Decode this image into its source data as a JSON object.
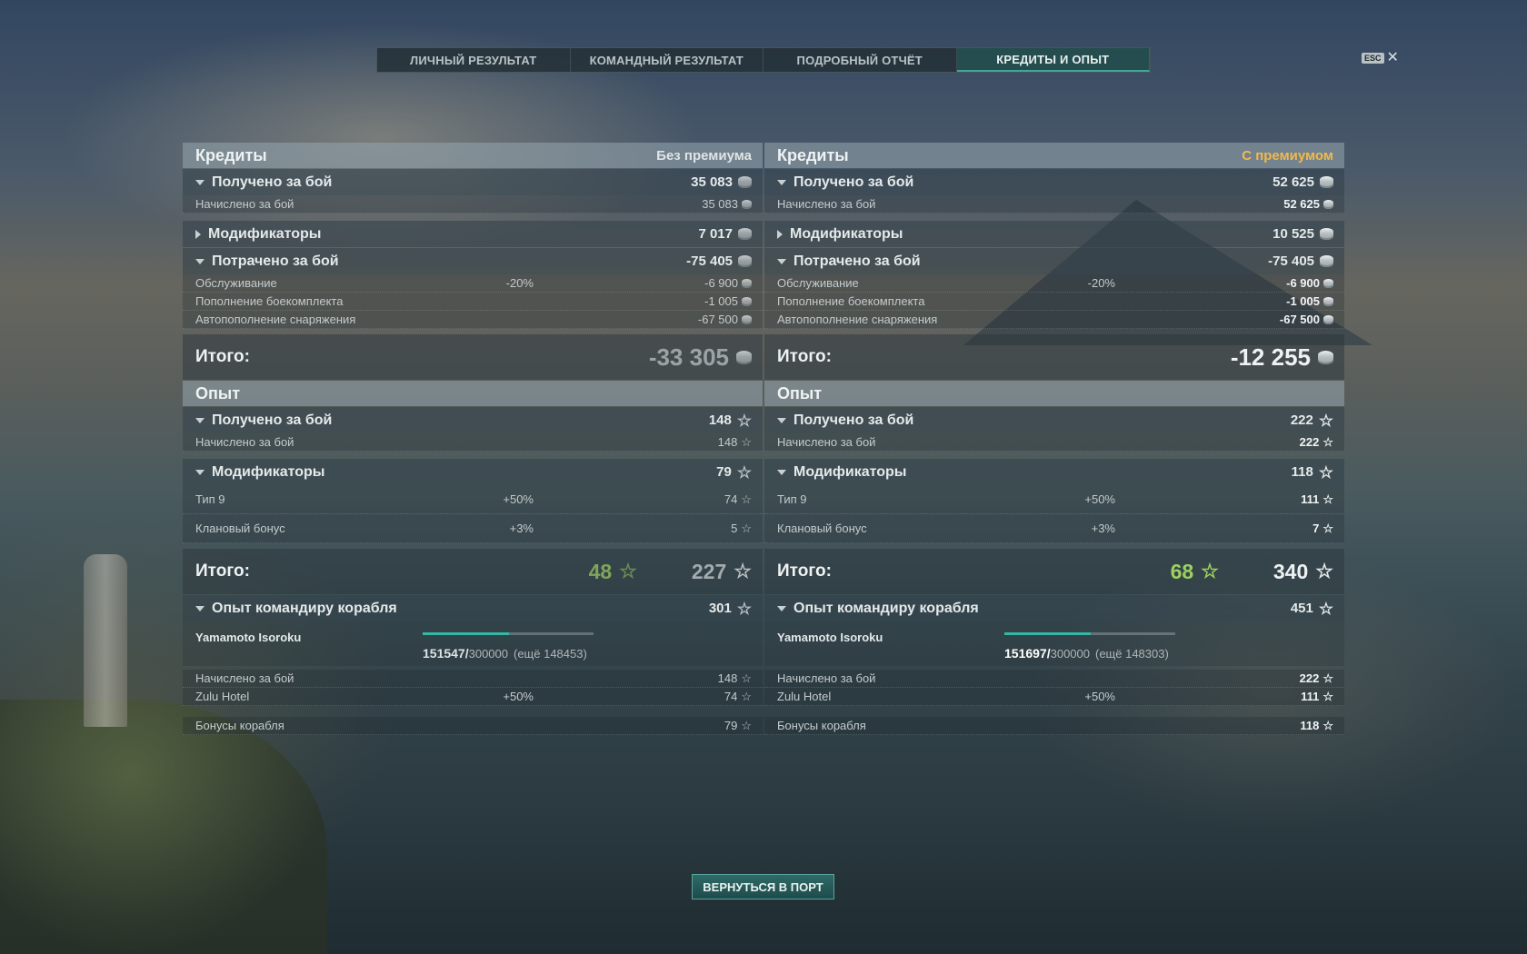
{
  "tabs": [
    "ЛИЧНЫЙ РЕЗУЛЬТАТ",
    "КОМАНДНЫЙ РЕЗУЛЬТАТ",
    "ПОДРОБНЫЙ ОТЧЁТ",
    "КРЕДИТЫ И ОПЫТ"
  ],
  "active_tab": 3,
  "esc": {
    "key": "ESC",
    "close": "✕"
  },
  "labels": {
    "credits": "Кредиты",
    "earned": "Получено за бой",
    "accrued": "Начислено за бой",
    "modifiers": "Модификаторы",
    "spent": "Потрачено за бой",
    "service": "Обслуживание",
    "ammo": "Пополнение боекомплекта",
    "consumables": "Автопополнение снаряжения",
    "total": "Итого:",
    "xp": "Опыт",
    "tier": "Тип 9",
    "clan": "Клановый бонус",
    "cmdr_xp": "Опыт командиру корабля",
    "cmdr_name": "Yamamoto Isoroku",
    "zulu": "Zulu Hotel",
    "ship_bonus": "Бонусы корабля"
  },
  "left": {
    "mode": "Без премиума",
    "credits": {
      "earned": "35 083",
      "accrued": "35 083",
      "modifiers": "7 017",
      "spent": "-75 405",
      "service_pct": "-20%",
      "service": "-6 900",
      "ammo": "-1 005",
      "consumables": "-67 500",
      "total": "-33 305"
    },
    "xp": {
      "earned": "148",
      "accrued": "148",
      "modifiers": "79",
      "tier_pct": "+50%",
      "tier": "74",
      "clan_pct": "+3%",
      "clan": "5",
      "total_free": "48",
      "total": "227"
    },
    "cmdr": {
      "total": "301",
      "current": "151547/",
      "max": "300000",
      "remaining": "(ещё 148453)",
      "progress": 0.505,
      "accrued": "148",
      "zulu_pct": "+50%",
      "zulu": "74",
      "ship_bonus": "79"
    }
  },
  "right": {
    "mode": "С премиумом",
    "credits": {
      "earned": "52 625",
      "accrued": "52 625",
      "modifiers": "10 525",
      "spent": "-75 405",
      "service_pct": "-20%",
      "service": "-6 900",
      "ammo": "-1 005",
      "consumables": "-67 500",
      "total": "-12 255"
    },
    "xp": {
      "earned": "222",
      "accrued": "222",
      "modifiers": "118",
      "tier_pct": "+50%",
      "tier": "111",
      "clan_pct": "+3%",
      "clan": "7",
      "total_free": "68",
      "total": "340"
    },
    "cmdr": {
      "total": "451",
      "current": "151697/",
      "max": "300000",
      "remaining": "(ещё 148303)",
      "progress": 0.506,
      "accrued": "222",
      "zulu_pct": "+50%",
      "zulu": "111",
      "ship_bonus": "118"
    }
  },
  "back_button": "ВЕРНУТЬСЯ В ПОРТ",
  "icons": {
    "credits": "coin-icon",
    "xp": "star-icon"
  },
  "colors": {
    "premium": "#f1b94a",
    "free_xp": "#9ed060",
    "accent": "#35b7a3"
  }
}
